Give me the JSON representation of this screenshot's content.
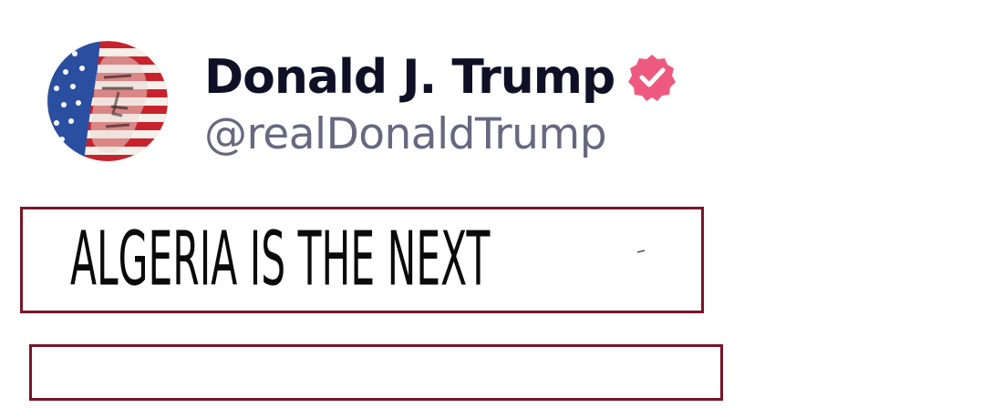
{
  "post": {
    "author": {
      "display_name": "Donald J. Trump",
      "handle": "@realDonaldTrump",
      "verified": true,
      "verified_icon": "verified-badge-icon",
      "avatar_icon": "flag-portrait-avatar"
    },
    "headline": "ALGERIA IS THE NEXT",
    "second_box_text": ""
  },
  "colors": {
    "display_name": "#0f1025",
    "handle": "#676880",
    "verified_badge": "#ee5a7f",
    "box_border": "#7a1428",
    "headline_text": "#0a0a0a",
    "flag_red": "#c8232c",
    "flag_blue": "#2a4fa0"
  }
}
